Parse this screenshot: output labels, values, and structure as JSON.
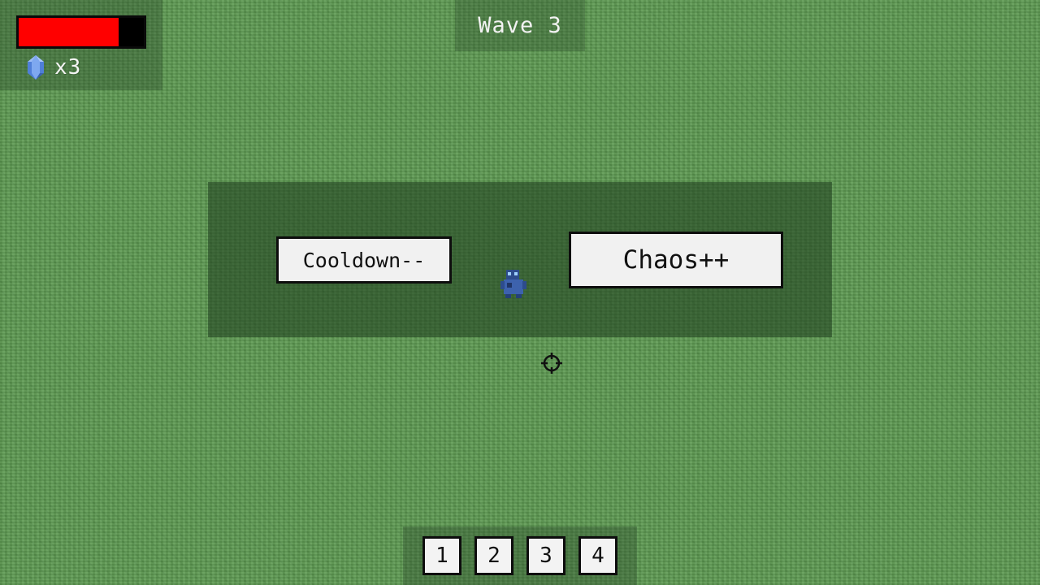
{
  "hud": {
    "health_fraction": 0.8,
    "health_color": "#ff0000",
    "gem_icon": "blue-gem-icon",
    "gem_count": "x3"
  },
  "wave": {
    "label": "Wave 3"
  },
  "upgrade_choices": {
    "left_label": "Cooldown--",
    "right_label": "Chaos++"
  },
  "player": {
    "icon": "blue-robot-player-icon"
  },
  "crosshair": {
    "icon": "crosshair-icon"
  },
  "hotbar": {
    "slots": [
      "1",
      "2",
      "3",
      "4"
    ]
  }
}
